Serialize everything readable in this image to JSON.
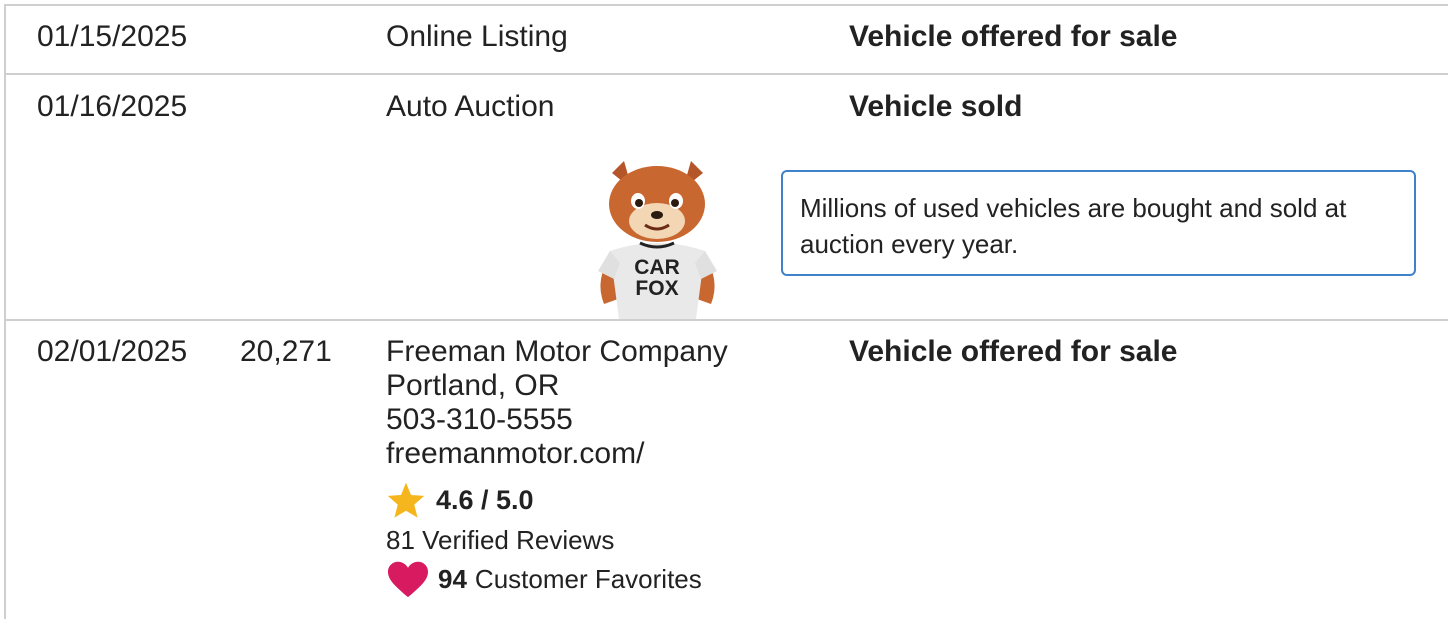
{
  "rows": [
    {
      "date": "01/15/2025",
      "odometer": "",
      "source": "Online Listing",
      "comment": "Vehicle offered for sale"
    },
    {
      "date": "01/16/2025",
      "odometer": "",
      "source": "Auto Auction",
      "comment": "Vehicle sold",
      "callout": "Millions of used vehicles are bought and sold at auction every year.",
      "mascot_text": [
        "CAR",
        "FOX"
      ]
    },
    {
      "date": "02/01/2025",
      "odometer": "20,271",
      "source_lines": [
        "Freeman Motor Company",
        "Portland, OR",
        "503-310-5555",
        "freemanmotor.com/"
      ],
      "comment": "Vehicle offered for sale",
      "rating": "4.6 / 5.0",
      "reviews": "81 Verified Reviews",
      "favorites_count": "94",
      "favorites_label": "Customer Favorites"
    }
  ],
  "colors": {
    "star": "#f5b51c",
    "heart": "#d81b60",
    "callout_border": "#3f82c9",
    "divider": "#cfcfcf"
  },
  "icons": {
    "rating": "star-icon",
    "favorites": "heart-icon"
  }
}
